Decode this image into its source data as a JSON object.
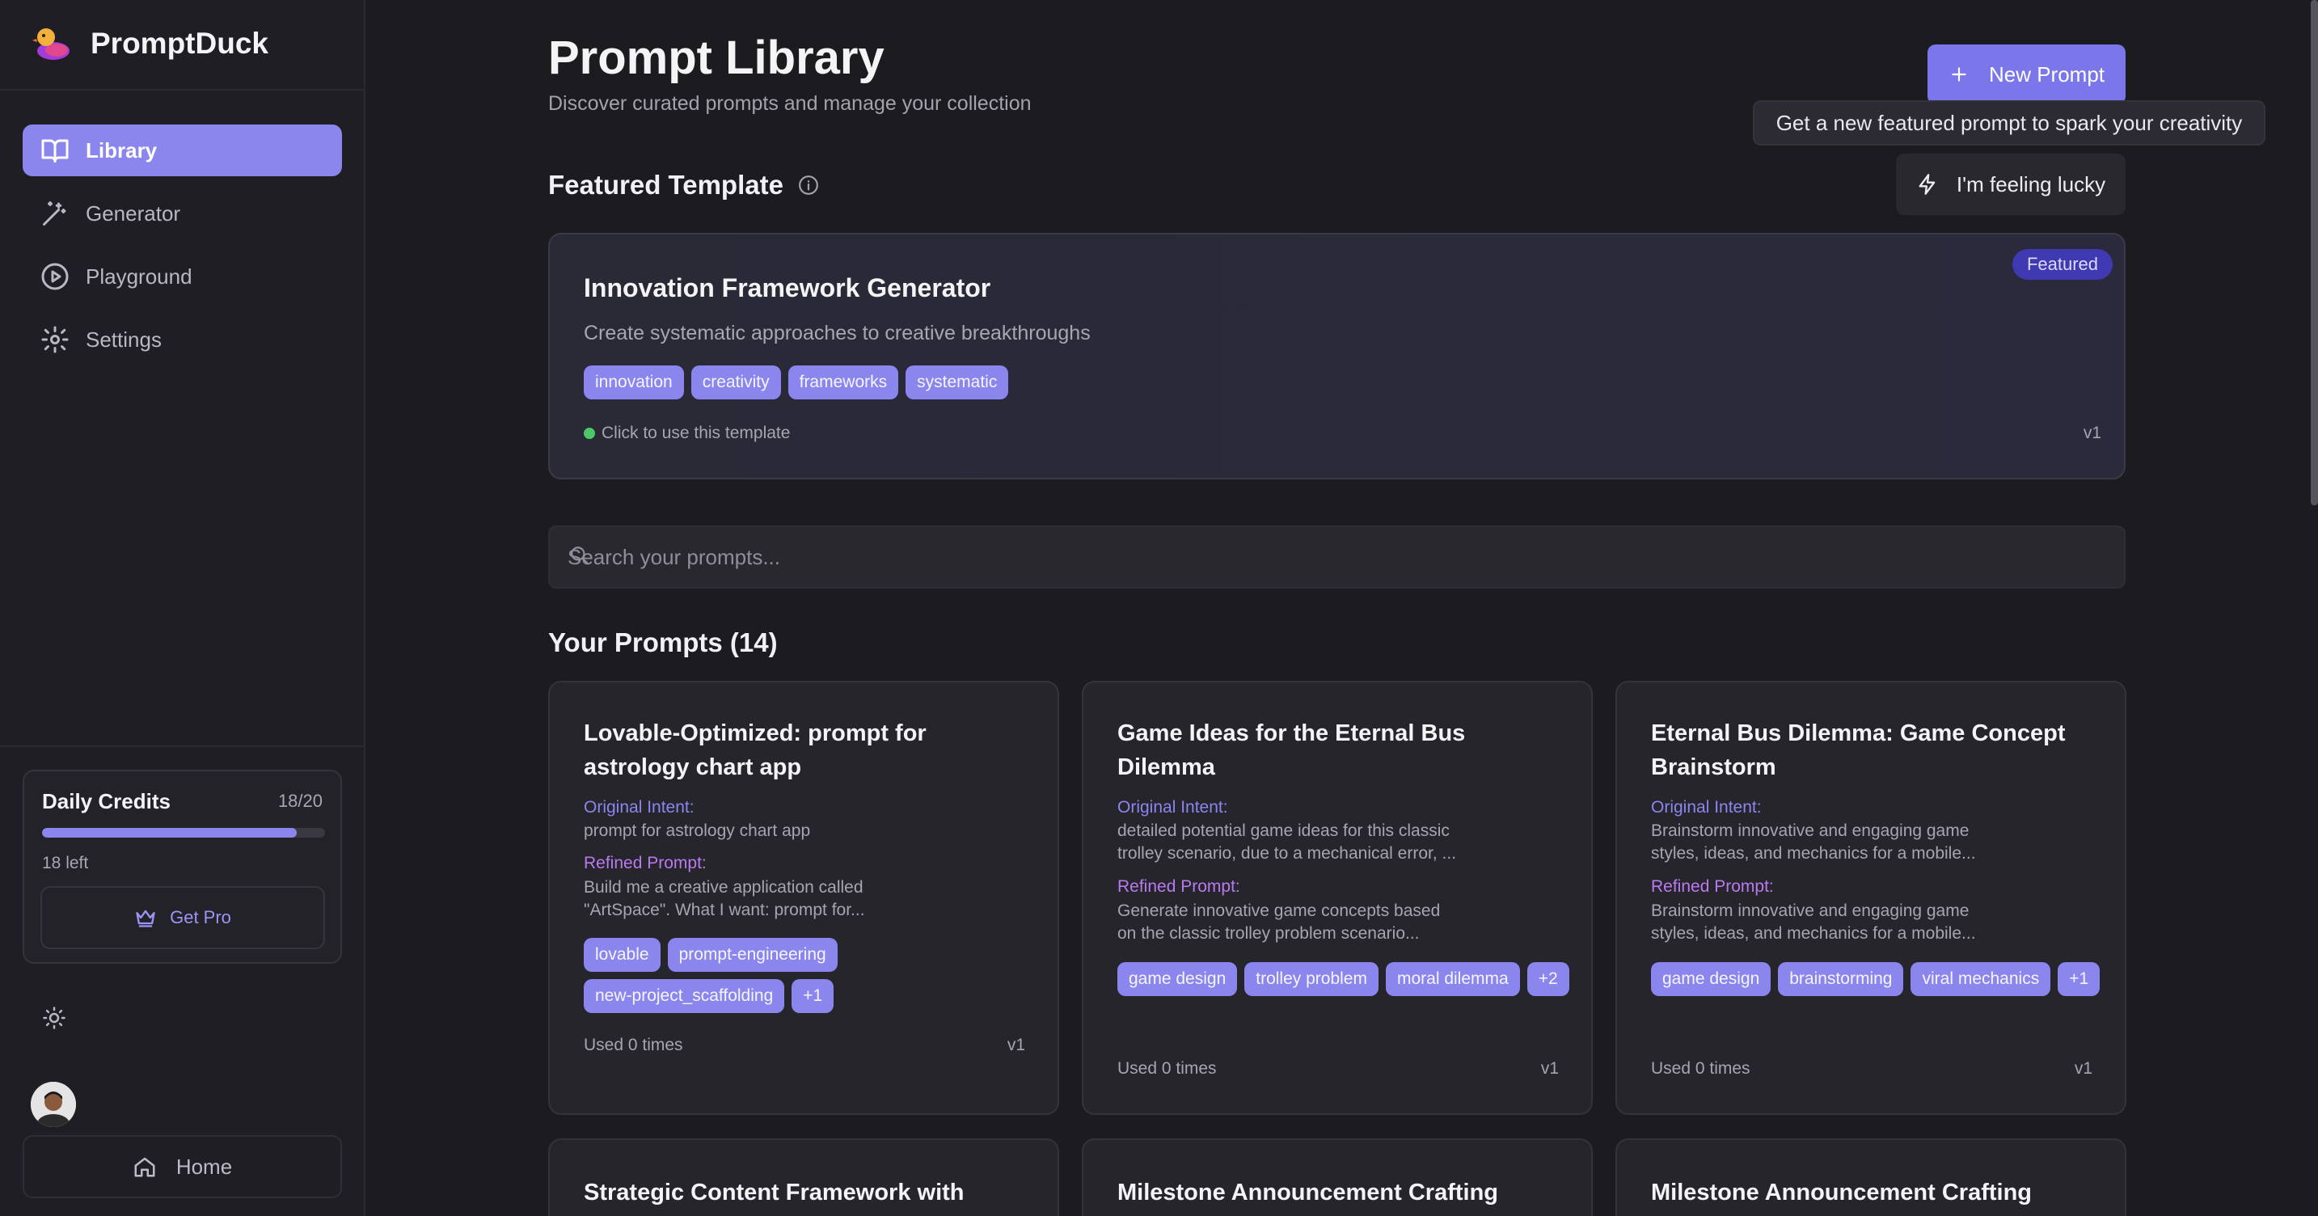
{
  "app": {
    "name": "PromptDuck"
  },
  "sidebar": {
    "items": [
      {
        "label": "Library",
        "icon": "book-icon",
        "active": true
      },
      {
        "label": "Generator",
        "icon": "wand-icon",
        "active": false
      },
      {
        "label": "Playground",
        "icon": "play-circle-icon",
        "active": false
      },
      {
        "label": "Settings",
        "icon": "gear-icon",
        "active": false
      }
    ],
    "credits": {
      "title": "Daily Credits",
      "count": "18/20",
      "fraction": 0.9,
      "left": "18 left",
      "get_pro": "Get Pro"
    },
    "home": "Home"
  },
  "header": {
    "title": "Prompt Library",
    "subtitle": "Discover curated prompts and manage your collection",
    "new_prompt": "New Prompt",
    "tooltip": "Get a new featured prompt to spark your creativity",
    "lucky": "I'm feeling lucky"
  },
  "featured": {
    "heading": "Featured Template",
    "title": "Innovation Framework Generator",
    "description": "Create systematic approaches to creative breakthroughs",
    "badge": "Featured",
    "tags": [
      "innovation",
      "creativity",
      "frameworks",
      "systematic"
    ],
    "hint": "Click to use this template",
    "version": "v1"
  },
  "search": {
    "placeholder": "Search your prompts..."
  },
  "prompts": {
    "heading": "Your Prompts (14)",
    "cards": [
      {
        "title": "Lovable-Optimized: prompt for astrology chart app",
        "intent_label": "Original Intent:",
        "intent": "prompt for astrology chart app",
        "refined_label": "Refined Prompt:",
        "refined_1": "Build me a creative application called",
        "refined_2": "\"ArtSpace\". What I want: prompt for...",
        "tags": [
          "lovable",
          "prompt-engineering",
          "new-project_scaffolding",
          "+1"
        ],
        "used": "Used 0 times",
        "version": "v1"
      },
      {
        "title": "Game Ideas for the Eternal Bus Dilemma",
        "intent_label": "Original Intent:",
        "intent_1": "detailed potential game ideas for this classic",
        "intent_2": "trolley scenario, due to a mechanical error, ...",
        "refined_label": "Refined Prompt:",
        "refined_1": "Generate innovative game concepts based",
        "refined_2": "on the classic trolley problem scenario...",
        "tags": [
          "game design",
          "trolley problem",
          "moral dilemma",
          "+2"
        ],
        "used": "Used 0 times",
        "version": "v1"
      },
      {
        "title": "Eternal Bus Dilemma: Game Concept Brainstorm",
        "intent_label": "Original Intent:",
        "intent_1": "Brainstorm innovative and engaging game",
        "intent_2": "styles, ideas, and mechanics for a mobile...",
        "refined_label": "Refined Prompt:",
        "refined_1": "Brainstorm innovative and engaging game",
        "refined_2": "styles, ideas, and mechanics for a mobile...",
        "tags": [
          "game design",
          "brainstorming",
          "viral mechanics",
          "+1"
        ],
        "used": "Used 0 times",
        "version": "v1"
      },
      {
        "title": "Strategic Content Framework with"
      },
      {
        "title": "Milestone Announcement Crafting"
      },
      {
        "title": "Milestone Announcement Crafting"
      }
    ]
  },
  "colors": {
    "accent": "#8b86ee",
    "background": "#1c1b20",
    "refined": "#b97aef",
    "featured_badge": "#3f3ab2"
  }
}
